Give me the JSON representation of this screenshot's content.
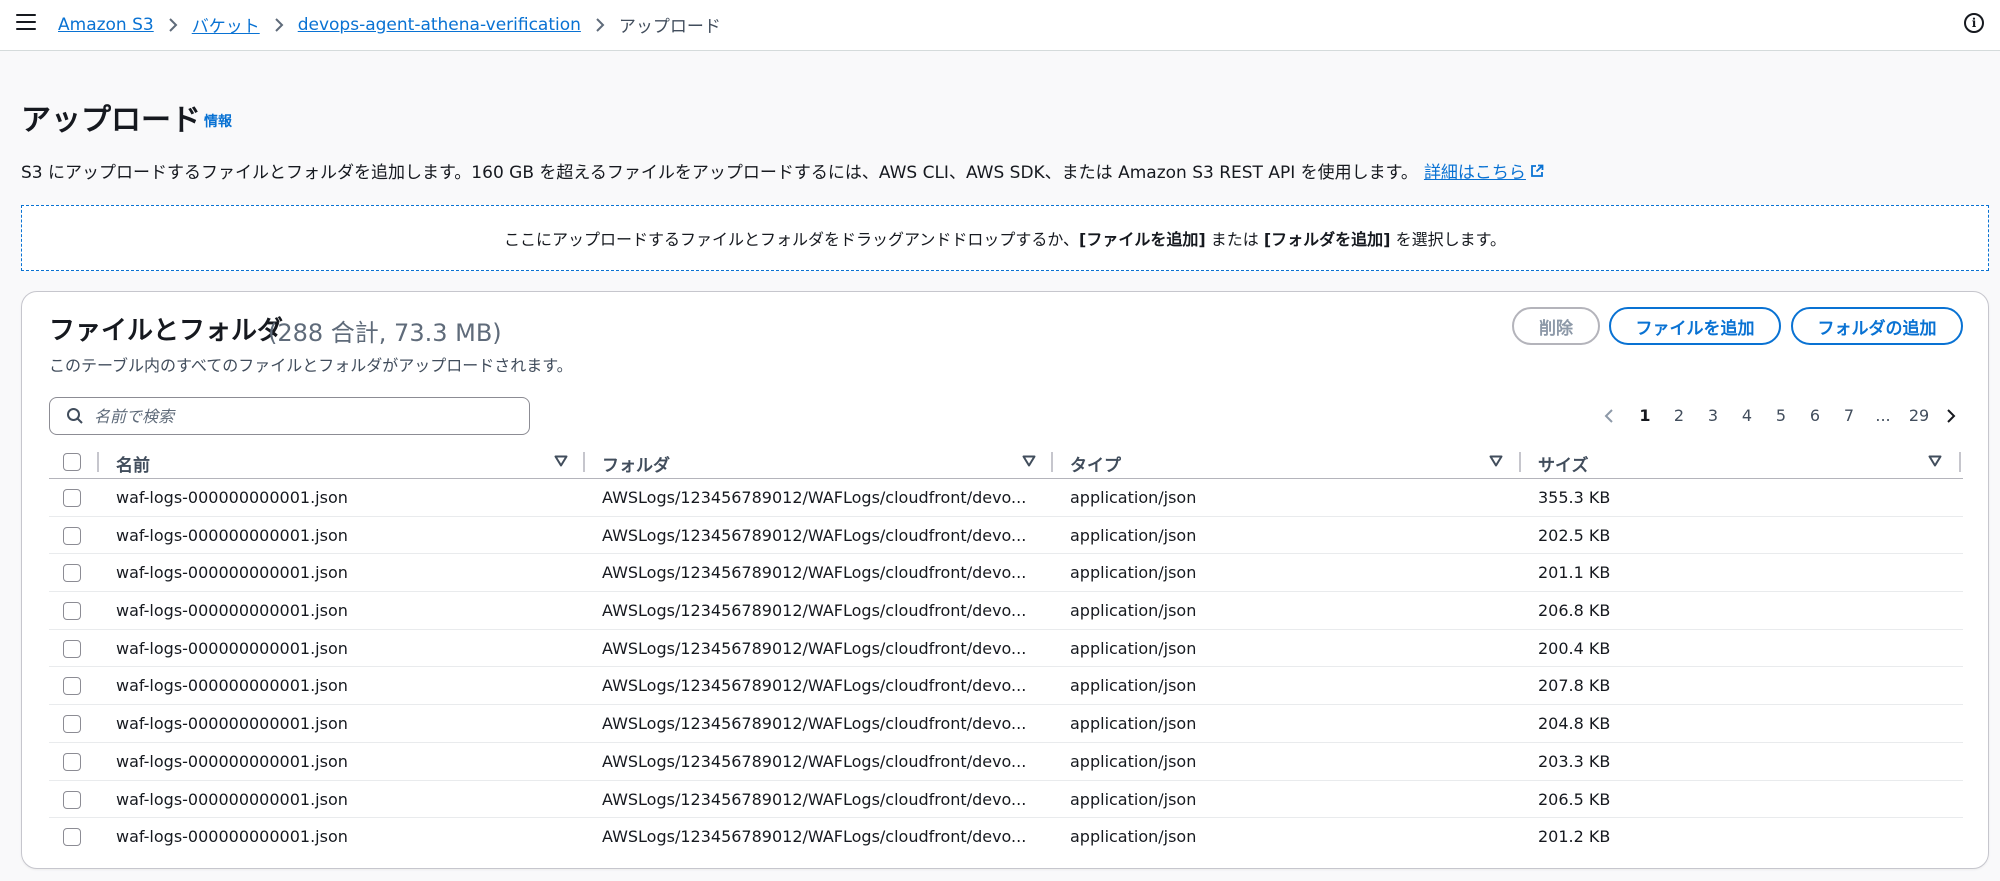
{
  "breadcrumb": {
    "items": [
      "Amazon S3",
      "バケット",
      "devops-agent-athena-verification"
    ],
    "current": "アップロード"
  },
  "page": {
    "title": "アップロード",
    "info_link": "情報",
    "description": "S3 にアップロードするファイルとフォルダを追加します。160 GB を超えるファイルをアップロードするには、AWS CLI、AWS SDK、または Amazon S3 REST API を使用します。",
    "learn_more": "詳細はこちら"
  },
  "dropzone": {
    "prefix": "ここにアップロードするファイルとフォルダをドラッグアンドドロップするか、",
    "add_files": "[ファイルを追加]",
    "middle": " または ",
    "add_folder": "[フォルダを追加]",
    "suffix": " を選択します。"
  },
  "files_panel": {
    "title": "ファイルとフォルダ",
    "count": "(288 合計, 73.3 MB)",
    "description": "このテーブル内のすべてのファイルとフォルダがアップロードされます。",
    "buttons": {
      "delete": "削除",
      "add_files": "ファイルを追加",
      "add_folder": "フォルダの追加"
    },
    "search_placeholder": "名前で検索",
    "pagination": {
      "pages": [
        "1",
        "2",
        "3",
        "4",
        "5",
        "6",
        "7",
        "...",
        "29"
      ],
      "current": "1"
    },
    "columns": [
      "名前",
      "フォルダ",
      "タイプ",
      "サイズ"
    ],
    "rows": [
      {
        "name": "waf-logs-000000000001.json",
        "folder": "AWSLogs/123456789012/WAFLogs/cloudfront/devo...",
        "type": "application/json",
        "size": "355.3 KB"
      },
      {
        "name": "waf-logs-000000000001.json",
        "folder": "AWSLogs/123456789012/WAFLogs/cloudfront/devo...",
        "type": "application/json",
        "size": "202.5 KB"
      },
      {
        "name": "waf-logs-000000000001.json",
        "folder": "AWSLogs/123456789012/WAFLogs/cloudfront/devo...",
        "type": "application/json",
        "size": "201.1 KB"
      },
      {
        "name": "waf-logs-000000000001.json",
        "folder": "AWSLogs/123456789012/WAFLogs/cloudfront/devo...",
        "type": "application/json",
        "size": "206.8 KB"
      },
      {
        "name": "waf-logs-000000000001.json",
        "folder": "AWSLogs/123456789012/WAFLogs/cloudfront/devo...",
        "type": "application/json",
        "size": "200.4 KB"
      },
      {
        "name": "waf-logs-000000000001.json",
        "folder": "AWSLogs/123456789012/WAFLogs/cloudfront/devo...",
        "type": "application/json",
        "size": "207.8 KB"
      },
      {
        "name": "waf-logs-000000000001.json",
        "folder": "AWSLogs/123456789012/WAFLogs/cloudfront/devo...",
        "type": "application/json",
        "size": "204.8 KB"
      },
      {
        "name": "waf-logs-000000000001.json",
        "folder": "AWSLogs/123456789012/WAFLogs/cloudfront/devo...",
        "type": "application/json",
        "size": "203.3 KB"
      },
      {
        "name": "waf-logs-000000000001.json",
        "folder": "AWSLogs/123456789012/WAFLogs/cloudfront/devo...",
        "type": "application/json",
        "size": "206.5 KB"
      },
      {
        "name": "waf-logs-000000000001.json",
        "folder": "AWSLogs/123456789012/WAFLogs/cloudfront/devo...",
        "type": "application/json",
        "size": "201.2 KB"
      }
    ]
  },
  "icons": {
    "menu": "menu-icon",
    "info": "info-icon",
    "external": "external-link-icon",
    "search": "search-icon",
    "sort": "sort-down-icon",
    "prev": "chevron-left-icon",
    "next": "chevron-right-icon"
  },
  "colors": {
    "link": "#0972d3",
    "text": "#16191f",
    "muted": "#5f6b7a",
    "background": "#f9f9fa"
  }
}
